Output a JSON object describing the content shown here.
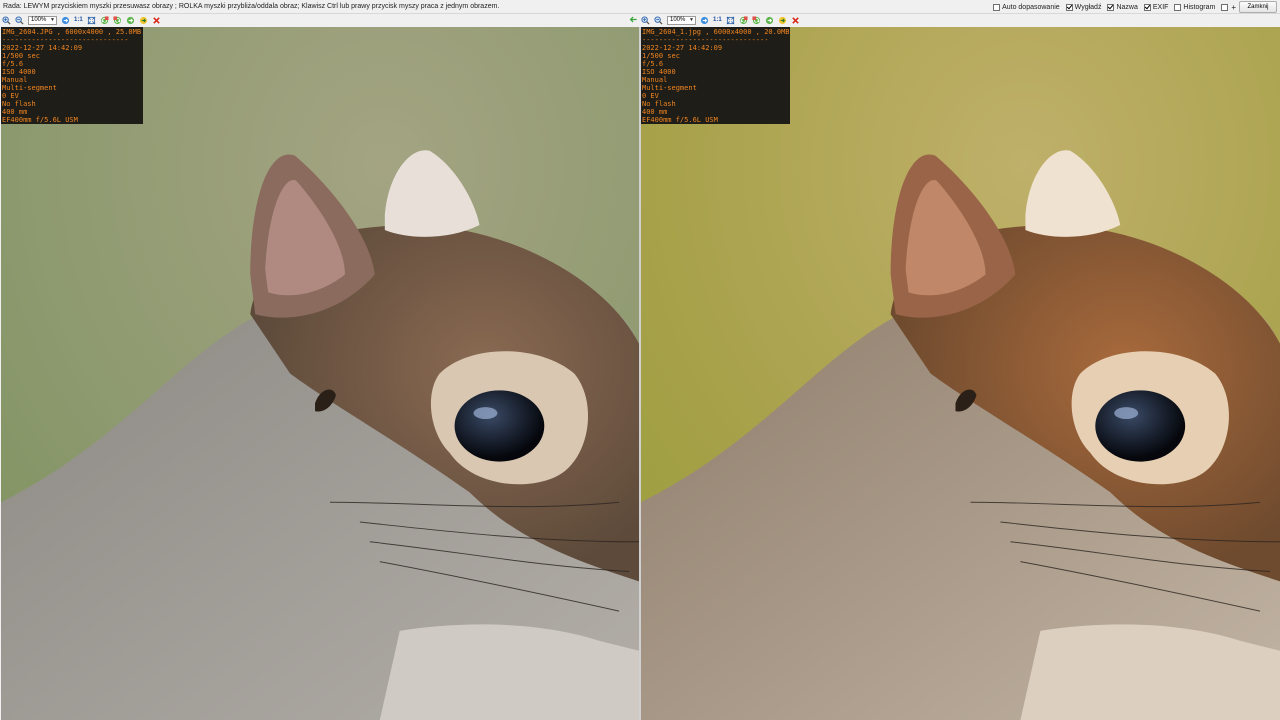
{
  "hint_text": "Rada: LEWYM przyciskiem myszki przesuwasz obrazy ; ROLKA myszki przybliża/oddala obraz; Klawisz Ctrl lub prawy przycisk myszy praca z jednym obrazem.",
  "options": [
    {
      "label": "Auto dopasowanie",
      "checked": false
    },
    {
      "label": "Wygładź",
      "checked": true
    },
    {
      "label": "Nazwa",
      "checked": true
    },
    {
      "label": "EXIF",
      "checked": true
    },
    {
      "label": "Histogram",
      "checked": false
    }
  ],
  "plus_label": "+",
  "close_label": "Zamknij",
  "toolbar": {
    "zoom_value": "100%",
    "one_to_one": "1:1"
  },
  "left_image": {
    "title": "IMG_2604.JPG , 6000x4000 , 25.0MB",
    "separator": "------------------------------",
    "exif": [
      "2022-12-27 14:42:09",
      "1/500 sec",
      "f/5.6",
      "ISO 4000",
      "Manual",
      "Multi-segment",
      "0 EV",
      "No flash",
      "400 mm",
      "EF400mm f/5.6L USM"
    ]
  },
  "right_image": {
    "title": "IMG_2604_1.jpg , 6000x4000 , 20.0MB",
    "separator": "------------------------------",
    "exif": [
      "2022-12-27 14:42:09",
      "1/500 sec",
      "f/5.6",
      "ISO 4000",
      "Manual",
      "Multi-segment",
      "0 EV",
      "No flash",
      "400 mm",
      "EF400mm f/5.6L USM"
    ]
  },
  "colors": {
    "exif_text": "#ef8420",
    "exif_bg": "#1e1d17",
    "left_background": "#8a9a6c",
    "right_background": "#a9a450"
  }
}
